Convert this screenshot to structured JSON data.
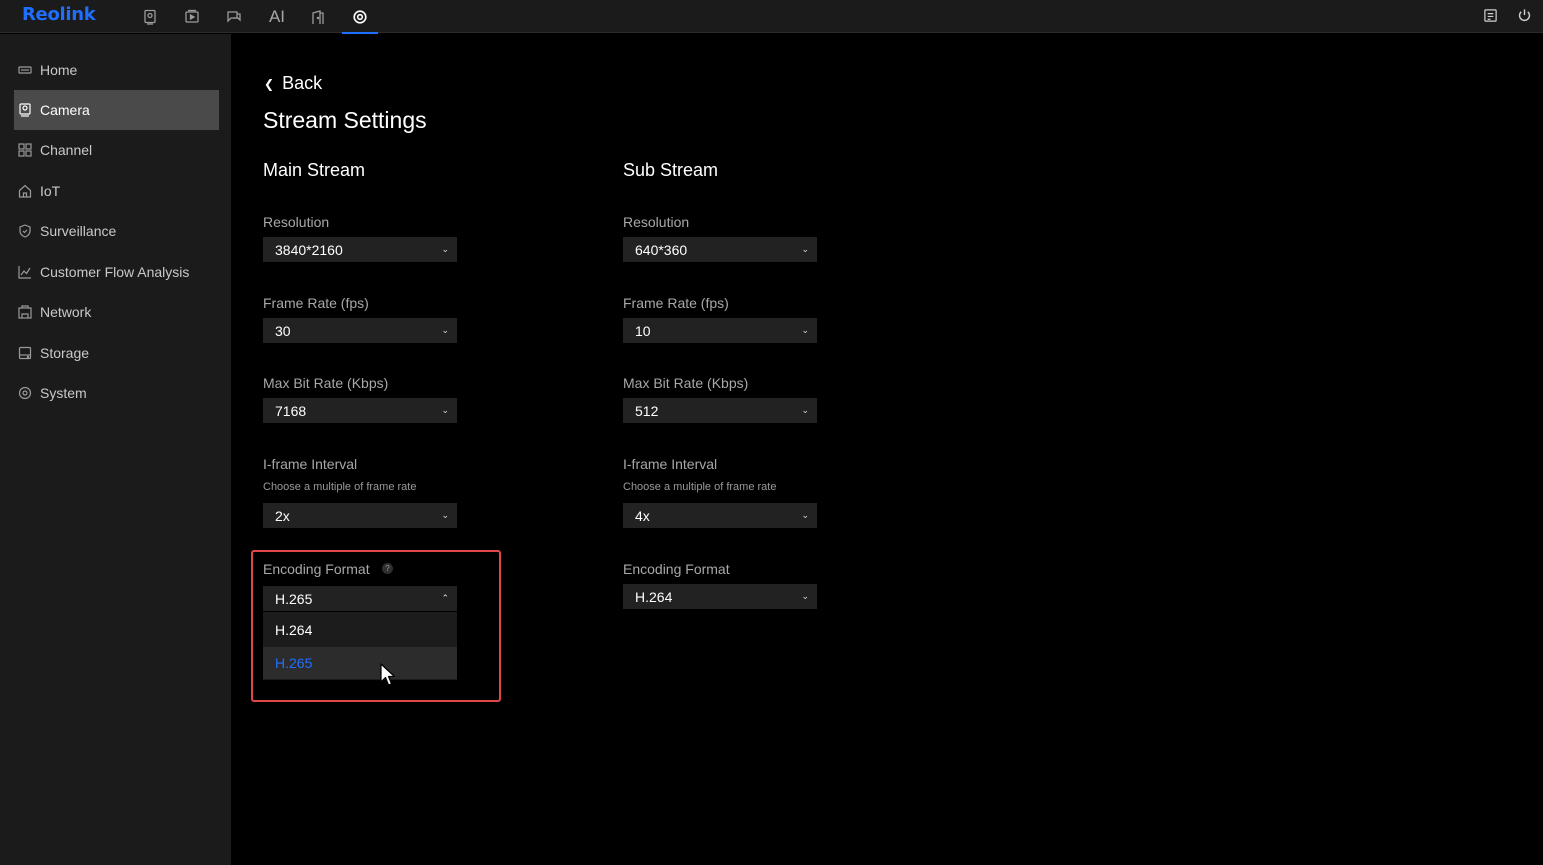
{
  "app": {
    "logo": "Reolink",
    "top_nav": [
      {
        "icon": "camera-icon"
      },
      {
        "icon": "playback-icon"
      },
      {
        "icon": "messages-icon"
      },
      {
        "label": "AI"
      },
      {
        "icon": "door-icon"
      },
      {
        "icon": "settings-icon",
        "active": true
      }
    ],
    "top_right": [
      {
        "icon": "notes-icon"
      },
      {
        "icon": "power-icon"
      }
    ],
    "accent_color": "#1f6fff"
  },
  "sidebar": {
    "items": [
      {
        "label": "Home",
        "icon": "home-icon"
      },
      {
        "label": "Camera",
        "icon": "camera-icon",
        "active": true
      },
      {
        "label": "Channel",
        "icon": "grid-icon"
      },
      {
        "label": "IoT",
        "icon": "house-icon"
      },
      {
        "label": "Surveillance",
        "icon": "shield-icon"
      },
      {
        "label": "Customer Flow Analysis",
        "icon": "chart-icon"
      },
      {
        "label": "Network",
        "icon": "network-icon"
      },
      {
        "label": "Storage",
        "icon": "storage-icon"
      },
      {
        "label": "System",
        "icon": "system-icon"
      }
    ]
  },
  "main": {
    "back_label": "Back",
    "title": "Stream Settings",
    "main_stream": {
      "title": "Main Stream",
      "resolution_label": "Resolution",
      "resolution": "3840*2160",
      "frame_rate_label": "Frame Rate (fps)",
      "frame_rate": "30",
      "bitrate_label": "Max Bit Rate (Kbps)",
      "bitrate": "7168",
      "iframe_label": "I-frame Interval",
      "iframe_hint": "Choose a multiple of frame rate",
      "iframe": "2x",
      "encoding_label": "Encoding Format",
      "encoding_help": "?",
      "encoding": "H.265",
      "encoding_options": [
        "H.264",
        "H.265"
      ]
    },
    "sub_stream": {
      "title": "Sub Stream",
      "resolution_label": "Resolution",
      "resolution": "640*360",
      "frame_rate_label": "Frame Rate (fps)",
      "frame_rate": "10",
      "bitrate_label": "Max Bit Rate (Kbps)",
      "bitrate": "512",
      "iframe_label": "I-frame Interval",
      "iframe_hint": "Choose a multiple of frame rate",
      "iframe": "4x",
      "encoding_label": "Encoding Format",
      "encoding": "H.264"
    }
  }
}
